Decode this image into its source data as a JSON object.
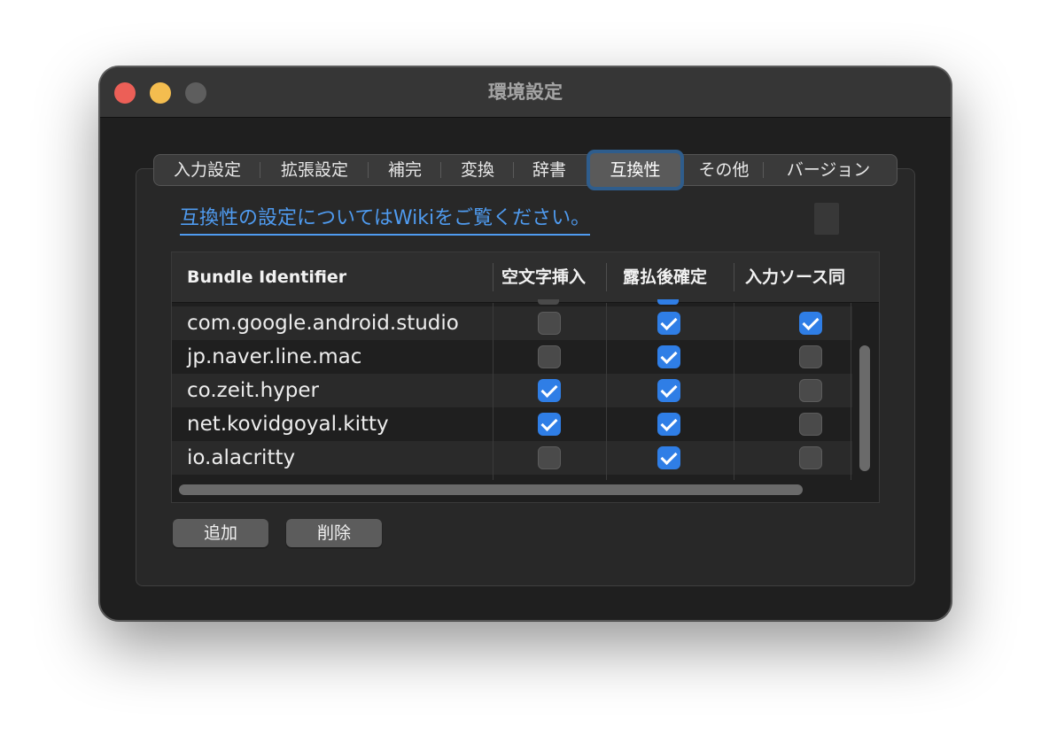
{
  "window": {
    "title": "環境設定"
  },
  "tabs": [
    {
      "label": "入力設定"
    },
    {
      "label": "拡張設定"
    },
    {
      "label": "補完"
    },
    {
      "label": "変換"
    },
    {
      "label": "辞書"
    },
    {
      "label": "互換性",
      "selected": true
    },
    {
      "label": "その他"
    },
    {
      "label": "バージョン"
    }
  ],
  "wiki_link": {
    "text": "互換性の設定についてはWikiをご覧ください。",
    "color": "#4f9bf0"
  },
  "table": {
    "columns": [
      "Bundle Identifier",
      "空文字挿入",
      "露払後確定",
      "入力ソース同"
    ],
    "rows": [
      {
        "id": "com.google.android.studio",
        "empty_insert": false,
        "confirm_after": true,
        "input_source_sync": true
      },
      {
        "id": "jp.naver.line.mac",
        "empty_insert": false,
        "confirm_after": true,
        "input_source_sync": false
      },
      {
        "id": "co.zeit.hyper",
        "empty_insert": true,
        "confirm_after": true,
        "input_source_sync": false
      },
      {
        "id": "net.kovidgoyal.kitty",
        "empty_insert": true,
        "confirm_after": true,
        "input_source_sync": false
      },
      {
        "id": "io.alacritty",
        "empty_insert": false,
        "confirm_after": true,
        "input_source_sync": false
      }
    ]
  },
  "buttons": {
    "add": "追加",
    "remove": "削除"
  },
  "colors": {
    "accent": "#2f7ee6",
    "close": "#ec5f57",
    "minimize": "#f4bd4f"
  }
}
